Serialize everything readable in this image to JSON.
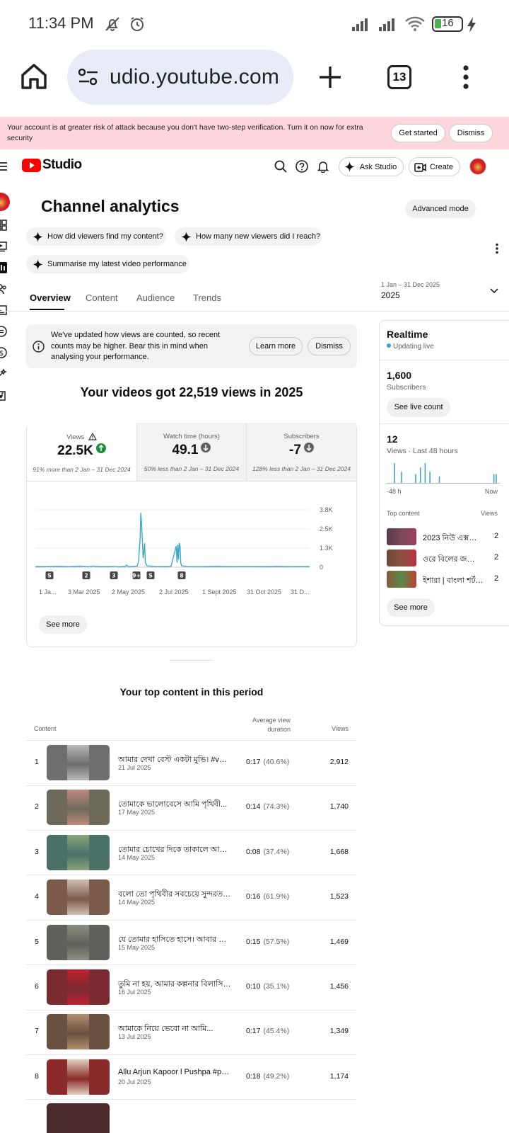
{
  "status": {
    "time": "11:34 PM",
    "battery": "16"
  },
  "browser": {
    "url": "udio.youtube.com",
    "tab_count": "13"
  },
  "banner": {
    "text": "Your account is at greater risk of attack because you don't have two-step verification. Turn it on now for extra security",
    "get_started": "Get started",
    "dismiss": "Dismiss"
  },
  "header": {
    "logo": "Studio",
    "ask": "Ask Studio",
    "create": "Create"
  },
  "page": {
    "title": "Channel analytics",
    "advanced": "Advanced mode",
    "chips": [
      "How did viewers find my content?",
      "How many new viewers did I reach?",
      "Summarise my latest video performance"
    ],
    "tabs": [
      "Overview",
      "Content",
      "Audience",
      "Trends"
    ],
    "date_range": "1 Jan – 31 Dec 2025",
    "date_year": "2025"
  },
  "notice": {
    "text": "We've updated how views are counted, so recent counts may be higher. Bear this in mind when analysing your performance.",
    "learn": "Learn more",
    "dismiss": "Dismiss"
  },
  "headline": "Your videos got 22,519 views in 2025",
  "metrics": [
    {
      "label": "Views",
      "value": "22.5K",
      "note": "91% more than 2 Jan – 31 Dec 2024",
      "trend": "up"
    },
    {
      "label": "Watch time (hours)",
      "value": "49.1",
      "note": "50% less than 2 Jan – 31 Dec 2024",
      "trend": "down"
    },
    {
      "label": "Subscribers",
      "value": "-7",
      "note": "128% less than 2 Jan – 31 Dec 2024",
      "trend": "down"
    }
  ],
  "chart_data": {
    "type": "line",
    "yticks": [
      "3.8K",
      "2.5K",
      "1.3K",
      "0"
    ],
    "xticks": [
      "1 Ja...",
      "3 Mar 2025",
      "2 May 2025",
      "2 Jul 2025",
      "1 Sept 2025",
      "31 Oct 2025",
      "31 D..."
    ],
    "markers": [
      "2",
      "3",
      "9+",
      "8"
    ],
    "ylim": [
      0,
      3800
    ],
    "series": [
      {
        "values": [
          [
            0,
            50
          ],
          [
            15,
            40
          ],
          [
            30,
            60
          ],
          [
            45,
            40
          ],
          [
            60,
            70
          ],
          [
            70,
            30
          ],
          [
            77,
            80
          ],
          [
            80,
            60
          ],
          [
            90,
            40
          ],
          [
            100,
            50
          ],
          [
            110,
            30
          ],
          [
            120,
            60
          ],
          [
            121,
            150
          ],
          [
            123,
            40
          ],
          [
            130,
            50
          ],
          [
            135,
            60
          ],
          [
            137,
            400
          ],
          [
            139,
            1900
          ],
          [
            140,
            3600
          ],
          [
            141,
            2800
          ],
          [
            142,
            1800
          ],
          [
            143,
            600
          ],
          [
            144,
            1000
          ],
          [
            145,
            1600
          ],
          [
            146,
            300
          ],
          [
            148,
            100
          ],
          [
            150,
            80
          ],
          [
            155,
            60
          ],
          [
            160,
            40
          ],
          [
            170,
            50
          ],
          [
            175,
            40
          ],
          [
            180,
            60
          ],
          [
            187,
            1400
          ],
          [
            188,
            300
          ],
          [
            189,
            1500
          ],
          [
            190,
            500
          ],
          [
            191,
            1600
          ],
          [
            192,
            1400
          ],
          [
            193,
            300
          ],
          [
            194,
            100
          ],
          [
            200,
            50
          ],
          [
            220,
            40
          ],
          [
            240,
            60
          ],
          [
            260,
            40
          ],
          [
            280,
            50
          ],
          [
            300,
            40
          ],
          [
            320,
            60
          ],
          [
            340,
            40
          ],
          [
            364,
            50
          ]
        ]
      }
    ]
  },
  "see_more": "See more",
  "realtime": {
    "title": "Realtime",
    "live": "Updating live",
    "subs_value": "1,600",
    "subs_label": "Subscribers",
    "live_count": "See live count",
    "views_value": "12",
    "views_label": "Views · Last 48 hours",
    "axis_left": "-48 h",
    "axis_right": "Now",
    "bars": [
      0,
      0,
      0,
      9,
      0,
      0,
      5,
      0,
      0,
      0,
      0,
      0,
      4,
      0,
      7,
      0,
      9,
      0,
      5,
      0,
      0,
      0,
      3,
      0,
      0,
      0,
      0,
      0,
      0,
      0,
      0,
      0,
      0,
      0,
      0,
      0,
      0,
      0,
      0,
      0,
      0,
      0,
      0,
      0,
      0,
      4,
      4
    ],
    "top_label": "Top content",
    "views_col": "Views",
    "items": [
      {
        "title": "2023 নিউ এক্সট্রা ...",
        "views": "2",
        "color": "#5a3a4a"
      },
      {
        "title": "ওরে বিলের জলে ...",
        "views": "2",
        "color": "#6b4a3a"
      },
      {
        "title": "ইশারা | বাংলা শর্ট ...",
        "views": "2",
        "color": "#8a5a3a"
      }
    ],
    "see_more": "See more"
  },
  "top_content": {
    "title": "Your top content in this period",
    "col_content": "Content",
    "col_avg": "Average view duration",
    "col_views": "Views",
    "rows": [
      {
        "rank": "1",
        "title": "আমার দেখা বেস্ট একটা মুভি। #vair...",
        "date": "21 Jul 2025",
        "avg": "0:17",
        "pct": "(40.6%)",
        "views": "2,912",
        "bg": "#6e6e6e",
        "fg": "#b9b9b9"
      },
      {
        "rank": "2",
        "title": "তোমাকে ভালোবেসে আমি পৃথিবী...",
        "date": "17 May 2025",
        "avg": "0:14",
        "pct": "(74.3%)",
        "views": "1,740",
        "bg": "#6e6a5a",
        "fg": "#c08a7a"
      },
      {
        "rank": "3",
        "title": "তোমার চোখের দিকে তাকালে আমি ব...",
        "date": "14 May 2025",
        "avg": "0:08",
        "pct": "(37.4%)",
        "views": "1,668",
        "bg": "#4a7068",
        "fg": "#8aa57a"
      },
      {
        "rank": "4",
        "title": "বলো তো পৃথিবীর সবচেয়ে সুন্দরতম ...",
        "date": "14 May 2025",
        "avg": "0:16",
        "pct": "(61.9%)",
        "views": "1,523",
        "bg": "#7a5a48",
        "fg": "#d0c0b0"
      },
      {
        "rank": "5",
        "title": "যে তোমার হাসিতে হাসে। আবার তুমি...",
        "date": "15 May 2025",
        "avg": "0:15",
        "pct": "(57.5%)",
        "views": "1,469",
        "bg": "#5e605c",
        "fg": "#8a9080"
      },
      {
        "rank": "6",
        "title": "তুমি না হয়, আমার কল্পনার বিলাসিতা ...",
        "date": "16 Jul 2025",
        "avg": "0:10",
        "pct": "(35.1%)",
        "views": "1,456",
        "bg": "#7a2a30",
        "fg": "#c02030"
      },
      {
        "rank": "7",
        "title": "আমাকে নিয়ে ভেবো না আমি...",
        "date": "13 Jul 2025",
        "avg": "0:17",
        "pct": "(45.4%)",
        "views": "1,349",
        "bg": "#6a5040",
        "fg": "#b09070"
      },
      {
        "rank": "8",
        "title": "Allu Arjun Kapoor l Pushpa #pus...",
        "date": "20 Jul 2025",
        "avg": "0:18",
        "pct": "(49.2%)",
        "views": "1,174",
        "bg": "#8a2a2a",
        "fg": "#e0d0c0"
      }
    ]
  }
}
